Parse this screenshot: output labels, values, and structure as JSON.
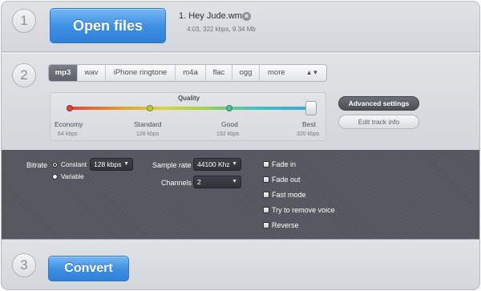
{
  "steps": {
    "one": "1",
    "two": "2",
    "three": "3"
  },
  "open_button": "Open files",
  "file": {
    "name": "1. Hey Jude.wma",
    "close_icon": "×",
    "meta": "4:03, 322 kbps, 9.34 Mb"
  },
  "format_tabs": {
    "items": [
      "mp3",
      "wav",
      "iPhone ringtone",
      "m4a",
      "flac",
      "ogg",
      "more"
    ],
    "selected": "mp3",
    "more_arrow": "▲▼"
  },
  "quality": {
    "title": "Quality",
    "value_fraction": 1.0,
    "levels": [
      {
        "label": "Economy",
        "bitrate": "64 kbps",
        "color": "#e0443a"
      },
      {
        "label": "Standard",
        "bitrate": "128 kbps",
        "color": "#b5cf3e"
      },
      {
        "label": "Good",
        "bitrate": "192 kbps",
        "color": "#46c2a0"
      },
      {
        "label": "Best",
        "bitrate": "320 kbps",
        "color": "#3aa6d8"
      }
    ]
  },
  "buttons": {
    "advanced": "Advanced settings",
    "edit_track": "Edit track info",
    "convert": "Convert"
  },
  "advanced": {
    "bitrate_label": "Bitrate",
    "bitrate_modes": [
      {
        "label": "Constant",
        "selected": true
      },
      {
        "label": "Variable",
        "selected": false
      }
    ],
    "bitrate_value": "128 kbps",
    "sample_rate_label": "Sample rate",
    "sample_rate_value": "44100 Khz",
    "channels_label": "Channels",
    "channels_value": "2",
    "options": [
      {
        "label": "Fade in",
        "checked": false
      },
      {
        "label": "Fade out",
        "checked": false
      },
      {
        "label": "Fast mode",
        "checked": false
      },
      {
        "label": "Try to remove voice",
        "checked": false
      },
      {
        "label": "Reverse",
        "checked": false
      }
    ]
  },
  "colors": {
    "accent_blue": "#3c8ee3",
    "panel_dark": "#54575f",
    "tab_active": "#6b7078"
  }
}
